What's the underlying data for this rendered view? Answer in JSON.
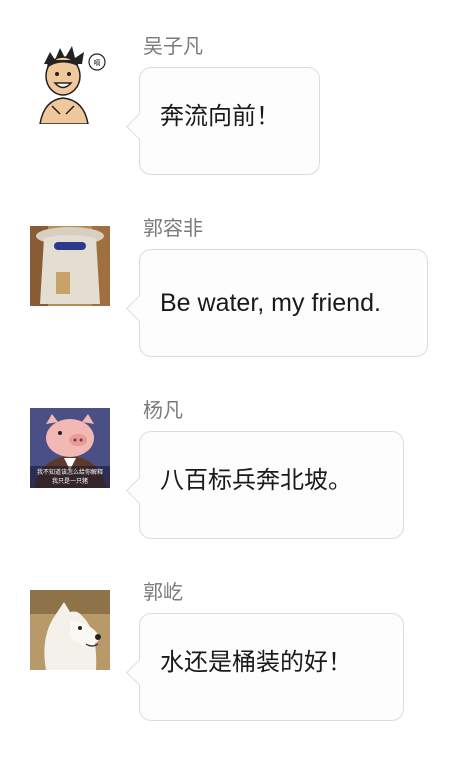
{
  "messages": [
    {
      "name": "吴子凡",
      "text": "奔流向前！",
      "avatar": "cartoon-avatar"
    },
    {
      "name": "郭容非",
      "text": "Be water, my friend.",
      "avatar": "veiled-person-avatar"
    },
    {
      "name": "杨凡",
      "text": "八百标兵奔北坡。",
      "avatar": "pig-cartoon-avatar",
      "avatar_caption": [
        "我不知道该怎么给你解释",
        "我只是一只猪"
      ]
    },
    {
      "name": "郭屹",
      "text": "水还是桶装的好！",
      "avatar": "samoyed-dog-avatar"
    }
  ]
}
